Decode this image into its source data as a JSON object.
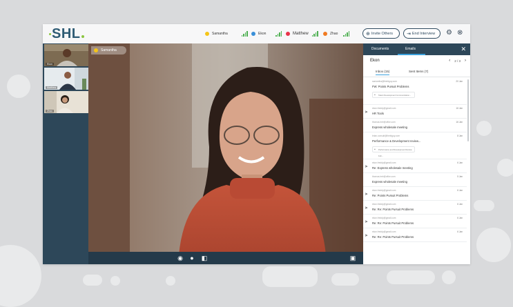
{
  "app": {
    "logo": "SHL",
    "brand_color": "#2e5b74",
    "accent_color": "#8bc53f"
  },
  "participants": [
    {
      "name": "Samantha",
      "color": "#f5c518"
    },
    {
      "name": "Ekon",
      "color": "#3a8fd8"
    },
    {
      "name": "Matthew",
      "color": "#e8334a"
    },
    {
      "name": "Zhao",
      "color": "#f07b22"
    }
  ],
  "buttons": {
    "invite": "Invite Others",
    "end": "End Interview"
  },
  "thumbnails": [
    "Ekon",
    "Matthew",
    "Zhao"
  ],
  "speaker": {
    "name": "Samantha"
  },
  "panel": {
    "tabs": [
      "Documents",
      "Emails"
    ],
    "title": "Ekon",
    "page": "2 / 3",
    "subtabs": [
      "Inbox (15)",
      "Sent Items (7)"
    ]
  },
  "emails": [
    {
      "from": "samantha@thebiguy.com",
      "subject": "FW: Points Pursuit Problems",
      "date": "20 Jan",
      "attachment": "Talent Development Communication...",
      "sent": false
    },
    {
      "from": "ekon.freddy@gmail.com",
      "subject": "HR Tools",
      "date": "16 Jan",
      "attachment": "",
      "sent": true
    },
    {
      "from": "thomas.heir@offce.com",
      "subject": "Express wholesale meeting",
      "date": "16 Jan",
      "attachment": "",
      "sent": false
    },
    {
      "from": "brian.consult@thebiguy.com",
      "subject": "Performance & Development review...",
      "date": "8 Jan",
      "attachment": "Performance and Development Review Feb...",
      "sent": false
    },
    {
      "from": "ekon.freddy@gmail.com",
      "subject": "Re: Express wholesale meeting",
      "date": "6 Jan",
      "attachment": "",
      "sent": true
    },
    {
      "from": "thomas.heir@offce.com",
      "subject": "Express wholesale meeting",
      "date": "5 Jan",
      "attachment": "",
      "sent": false
    },
    {
      "from": "ekon.freddy@gmail.com",
      "subject": "Re: Points Pursuit Problems",
      "date": "6 Jan",
      "attachment": "",
      "sent": true
    },
    {
      "from": "ekon.freddy@gmail.com",
      "subject": "Re: Re: Points Pursuit Problems",
      "date": "6 Jan",
      "attachment": "",
      "sent": true
    },
    {
      "from": "ekon.freddy@gmail.com",
      "subject": "Re: Re: Points Pursuit Problems",
      "date": "6 Jan",
      "attachment": "",
      "sent": true
    },
    {
      "from": "ekon.freddy@gmail.com",
      "subject": "Re: Re: Points Pursuit Problems",
      "date": "6 Jan",
      "attachment": "",
      "sent": true
    }
  ]
}
